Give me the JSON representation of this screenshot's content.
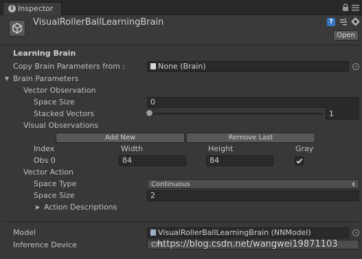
{
  "window": {
    "tab_label": "Inspector"
  },
  "header": {
    "title": "VisualRollerBallLearningBrain",
    "open_label": "Open"
  },
  "learning_brain": {
    "section_title": "Learning Brain",
    "copy_label": "Copy Brain Parameters from :",
    "copy_value": "None (Brain)"
  },
  "brain_parameters": {
    "label": "Brain Parameters",
    "vector_observation": {
      "label": "Vector Observation",
      "space_size_label": "Space Size",
      "space_size_value": "0",
      "stacked_vectors_label": "Stacked Vectors",
      "stacked_vectors_value": "1"
    },
    "visual_observations": {
      "label": "Visual Observations",
      "add_new_label": "Add New",
      "remove_last_label": "Remove Last",
      "col_index": "Index",
      "col_width": "Width",
      "col_height": "Height",
      "col_gray": "Gray",
      "rows": [
        {
          "name": "Obs 0",
          "width": "84",
          "height": "84",
          "gray": true
        }
      ]
    },
    "vector_action": {
      "label": "Vector Action",
      "space_type_label": "Space Type",
      "space_type_value": "Continuous",
      "space_size_label": "Space Size",
      "space_size_value": "2",
      "action_descriptions_label": "Action Descriptions"
    }
  },
  "model": {
    "model_label": "Model",
    "model_value": "VisualRollerBallLearningBrain (NNModel)",
    "device_label": "Inference Device",
    "device_value": "CPU"
  },
  "watermark": "https://blog.csdn.net/wangwei19871103",
  "colors": {
    "panel_bg": "#383838",
    "field_bg": "#2a2a2a",
    "button_bg": "#585858",
    "tab_bar": "#282828"
  },
  "icons": [
    "info-icon",
    "lock-icon",
    "menu-icon",
    "help-icon",
    "presets-icon",
    "settings-icon",
    "unity-logo-icon",
    "object-picker-icon",
    "checkbox-check-icon",
    "foldout-arrow-icon"
  ]
}
